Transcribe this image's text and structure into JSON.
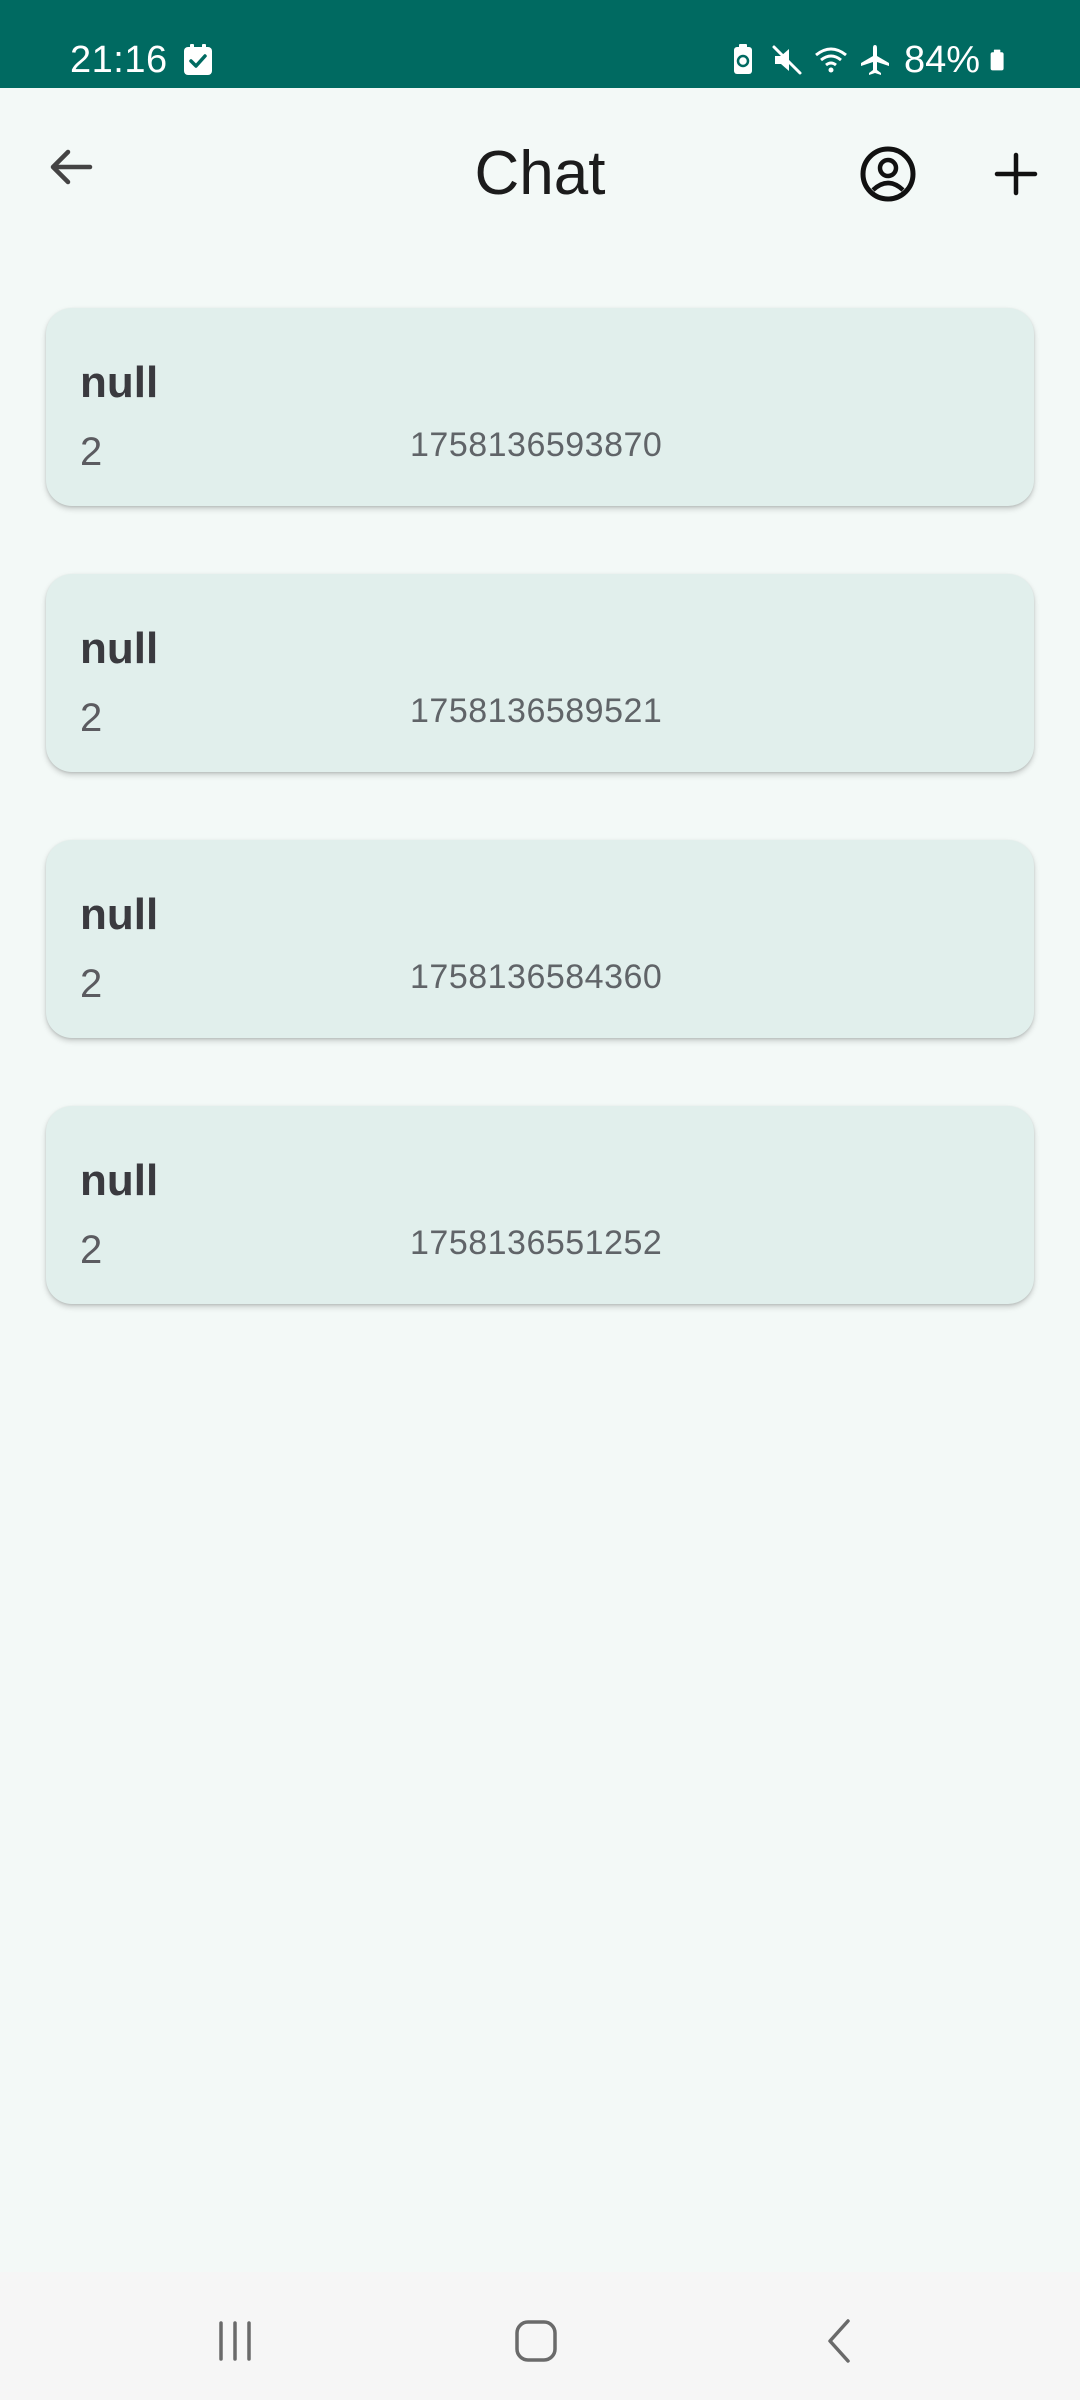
{
  "status_bar": {
    "time": "21:16",
    "battery": "84%",
    "icons": [
      "check-notification-icon",
      "battery-saver-icon",
      "mute-icon",
      "wifi-icon",
      "airplane-icon",
      "battery-icon"
    ]
  },
  "app_bar": {
    "title": "Chat",
    "icons": [
      "back-arrow-icon",
      "profile-icon",
      "add-icon"
    ]
  },
  "chats": [
    {
      "name": "null",
      "count": "2",
      "timestamp": "1758136593870"
    },
    {
      "name": "null",
      "count": "2",
      "timestamp": "1758136589521"
    },
    {
      "name": "null",
      "count": "2",
      "timestamp": "1758136584360"
    },
    {
      "name": "null",
      "count": "2",
      "timestamp": "1758136551252"
    }
  ],
  "nav_bar": {
    "icons": [
      "recent-apps-icon",
      "home-icon",
      "nav-back-icon"
    ]
  },
  "colors": {
    "status_bar": "#006a61",
    "background": "#f3f9f7",
    "card": "#e1efec"
  }
}
